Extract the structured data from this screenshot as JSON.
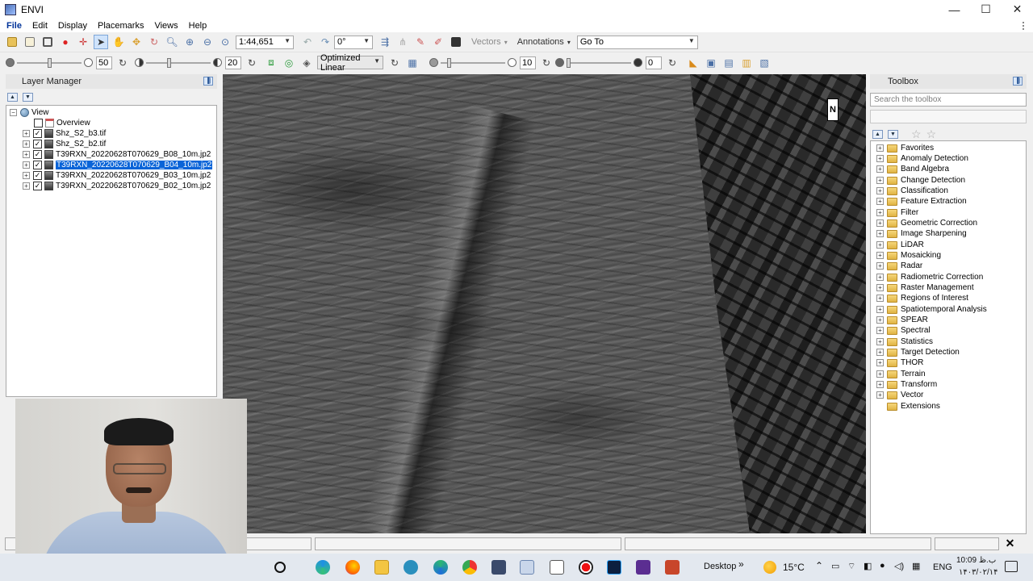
{
  "window": {
    "title": "ENVI",
    "minimize": "—",
    "maximize": "☐",
    "close": "✕"
  },
  "menu": [
    "File",
    "Edit",
    "Display",
    "Placemarks",
    "Views",
    "Help"
  ],
  "toolbar1": {
    "scale_value": "1:44,651",
    "rotation_value": "0°",
    "vectors_label": "Vectors",
    "annotations_label": "Annotations",
    "goto_label": "Go To"
  },
  "toolbar2": {
    "brightness": {
      "value": "50",
      "level": 0.5
    },
    "contrast": {
      "value": "20",
      "level": 0.35
    },
    "stretch_label": "Optimized Linear",
    "sharpen": {
      "value": "10",
      "level": 0.1
    },
    "transparency": {
      "value": "0",
      "level": 0.0
    }
  },
  "layer_manager": {
    "title": "Layer Manager",
    "root": "View",
    "overview": "Overview",
    "layers": [
      {
        "name": "Shz_S2_b3.tif",
        "checked": true,
        "selected": false
      },
      {
        "name": "Shz_S2_b2.tif",
        "checked": true,
        "selected": false
      },
      {
        "name": "T39RXN_20220628T070629_B08_10m.jp2",
        "checked": true,
        "selected": false
      },
      {
        "name": "T39RXN_20220628T070629_B04_10m.jp2",
        "checked": true,
        "selected": true
      },
      {
        "name": "T39RXN_20220628T070629_B03_10m.jp2",
        "checked": true,
        "selected": false
      },
      {
        "name": "T39RXN_20220628T070629_B02_10m.jp2",
        "checked": true,
        "selected": false
      }
    ]
  },
  "map": {
    "north_label": "N"
  },
  "toolbox": {
    "title": "Toolbox",
    "search_placeholder": "Search the toolbox",
    "items": [
      "Favorites",
      "Anomaly Detection",
      "Band Algebra",
      "Change Detection",
      "Classification",
      "Feature Extraction",
      "Filter",
      "Geometric Correction",
      "Image Sharpening",
      "LiDAR",
      "Mosaicking",
      "Radar",
      "Radiometric Correction",
      "Raster Management",
      "Regions of Interest",
      "Spatiotemporal Analysis",
      "SPEAR",
      "Spectral",
      "Statistics",
      "Target Detection",
      "THOR",
      "Terrain",
      "Transform",
      "Vector",
      "Extensions"
    ]
  },
  "taskbar": {
    "desktop_label": "Desktop",
    "temperature": "15°C",
    "language": "ENG",
    "time": "10:09 ب.ظ",
    "date": "۱۴۰۳/۰۲/۱۴"
  },
  "colors": {
    "accent": "#0a64d8",
    "menu_active": "#003399",
    "folder": "#f0c75b"
  }
}
